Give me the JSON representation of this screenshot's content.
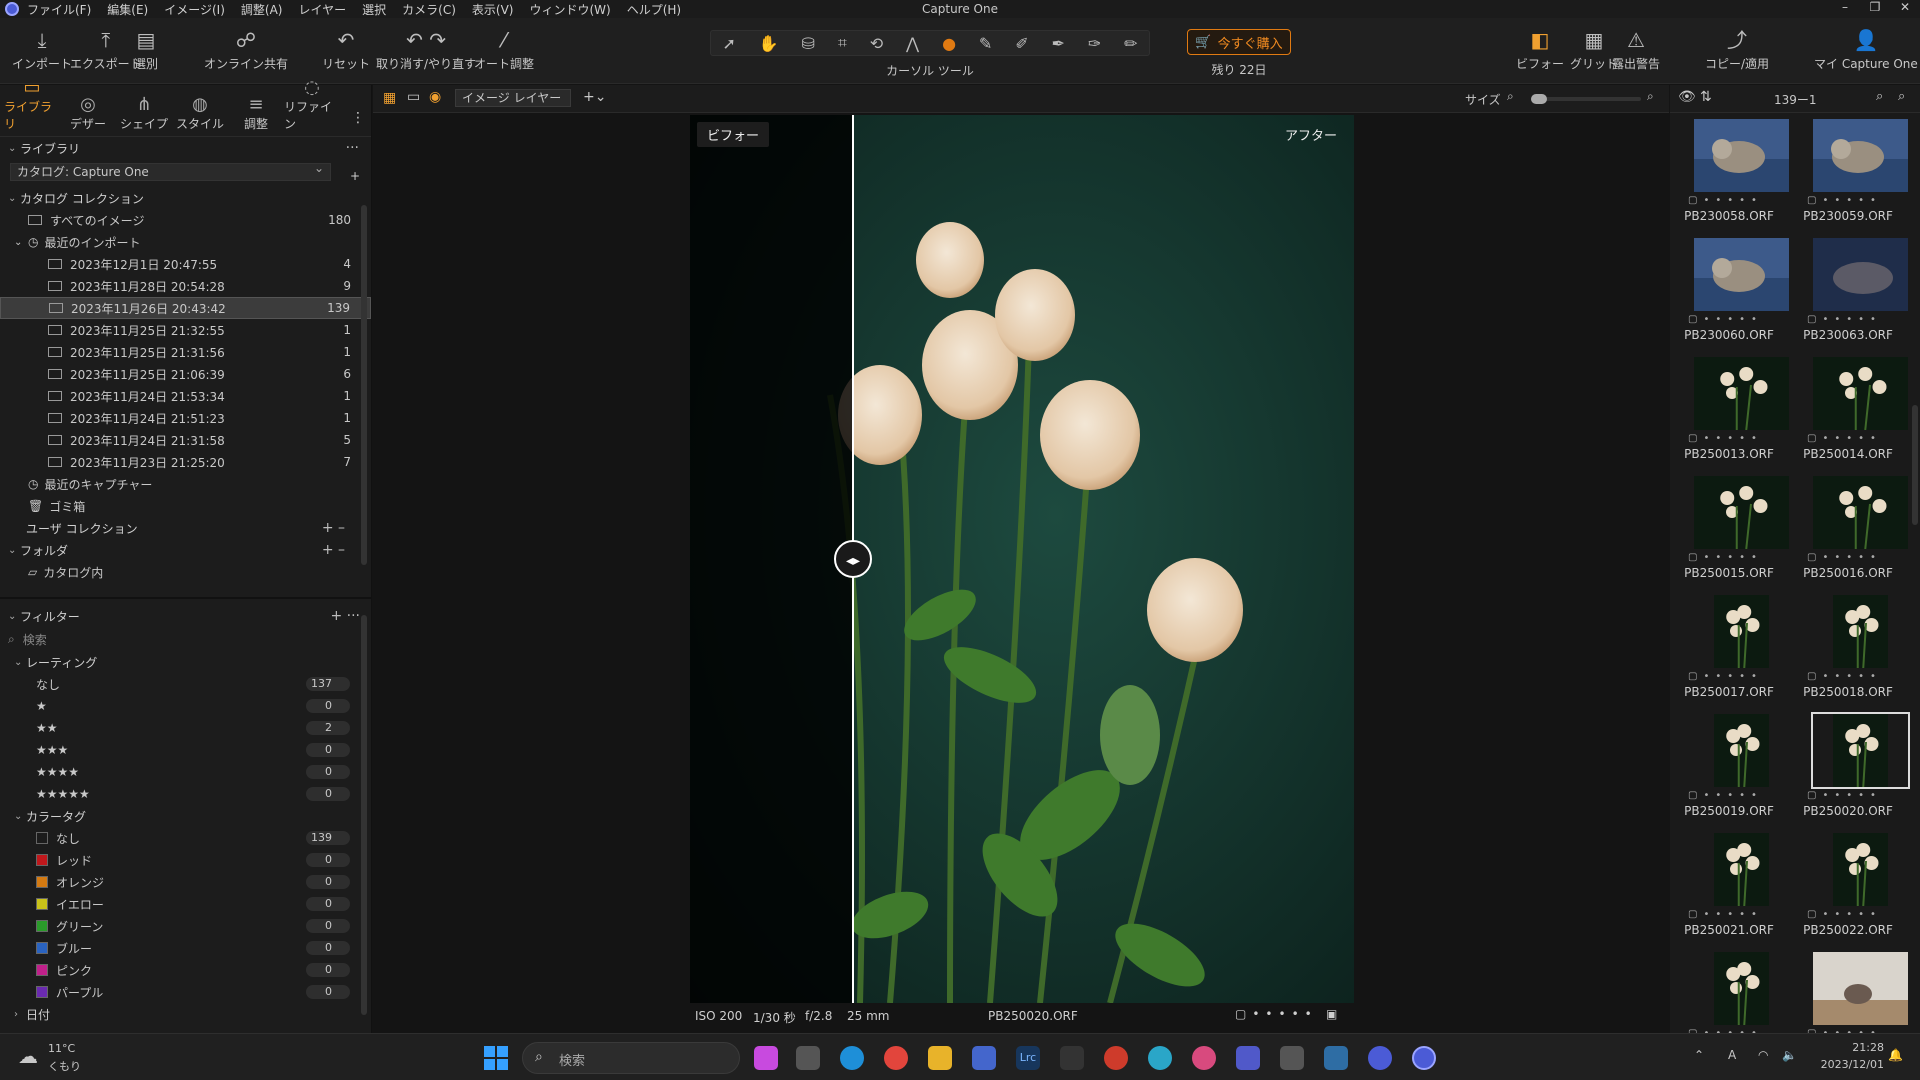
{
  "window": {
    "title": "Capture One"
  },
  "menu": [
    "ファイル(F)",
    "編集(E)",
    "イメージ(I)",
    "調整(A)",
    "レイヤー",
    "選択",
    "カメラ(C)",
    "表示(V)",
    "ウィンドウ(W)",
    "ヘルプ(H)"
  ],
  "toolbar": {
    "import": "インポート",
    "export": "エクスポート",
    "cull": "選別",
    "share": "オンライン共有",
    "reset": "リセット",
    "undo_redo": "取り消す/やり直す",
    "auto": "オート調整",
    "cursor_tools": "カーソル ツール",
    "buy": "今すぐ購入",
    "remaining": "残り 22日",
    "before": "ビフォー",
    "grid": "グリッド",
    "exposure_warning": "露出警告",
    "copy_apply": "コピー/適用",
    "my_capture_one": "マイ Capture One"
  },
  "tool_tabs": [
    "ライブラリ",
    "デザー",
    "シェイプ",
    "スタイル",
    "調整",
    "リファイン"
  ],
  "library": {
    "title": "ライブラリ",
    "catalog_select": "カタログ: Capture One",
    "catalog_collection": "カタログ コレクション",
    "all_images": {
      "label": "すべてのイメージ",
      "count": "180"
    },
    "recent_imports": "最近のインポート",
    "imports": [
      {
        "label": "2023年12月1日 20:47:55",
        "count": "4"
      },
      {
        "label": "2023年11月28日 20:54:28",
        "count": "9"
      },
      {
        "label": "2023年11月26日 20:43:42",
        "count": "139"
      },
      {
        "label": "2023年11月25日 21:32:55",
        "count": "1"
      },
      {
        "label": "2023年11月25日 21:31:56",
        "count": "1"
      },
      {
        "label": "2023年11月25日 21:06:39",
        "count": "6"
      },
      {
        "label": "2023年11月24日 21:53:34",
        "count": "1"
      },
      {
        "label": "2023年11月24日 21:51:23",
        "count": "1"
      },
      {
        "label": "2023年11月24日 21:31:58",
        "count": "5"
      },
      {
        "label": "2023年11月23日 21:25:20",
        "count": "7"
      }
    ],
    "recent_captures": "最近のキャプチャー",
    "trash": "ゴミ箱",
    "user_collections": "ユーザ コレクション",
    "folders": "フォルダ",
    "in_catalog": "カタログ内"
  },
  "filters": {
    "title": "フィルター",
    "search_placeholder": "検索",
    "rating_title": "レーティング",
    "ratings": [
      {
        "label": "なし",
        "count": "137"
      },
      {
        "label": "★",
        "count": "0"
      },
      {
        "label": "★★",
        "count": "2"
      },
      {
        "label": "★★★",
        "count": "0"
      },
      {
        "label": "★★★★",
        "count": "0"
      },
      {
        "label": "★★★★★",
        "count": "0"
      }
    ],
    "color_title": "カラータグ",
    "colors": [
      {
        "label": "なし",
        "count": "139",
        "color": "#1c1c1c"
      },
      {
        "label": "レッド",
        "count": "0",
        "color": "#c0181c"
      },
      {
        "label": "オレンジ",
        "count": "0",
        "color": "#d47a12"
      },
      {
        "label": "イエロー",
        "count": "0",
        "color": "#c9c21a"
      },
      {
        "label": "グリーン",
        "count": "0",
        "color": "#2a9a2a"
      },
      {
        "label": "ブルー",
        "count": "0",
        "color": "#2a63c0"
      },
      {
        "label": "ピンク",
        "count": "0",
        "color": "#c0208a"
      },
      {
        "label": "パープル",
        "count": "0",
        "color": "#6a2ab0"
      }
    ],
    "date_title": "日付"
  },
  "viewer": {
    "layer_select": "イメージ レイヤー",
    "size_label": "サイズ",
    "before_label": "ビフォー",
    "after_label": "アフター",
    "iso": "ISO 200",
    "shutter": "1/30 秒",
    "aperture": "f/2.8",
    "focal": "25 mm",
    "filename": "PB250020.ORF"
  },
  "browser": {
    "count": "139ー1",
    "thumbs": [
      {
        "name": "PB230058.ORF",
        "kind": "cat"
      },
      {
        "name": "PB230059.ORF",
        "kind": "cat"
      },
      {
        "name": "PB230060.ORF",
        "kind": "cat"
      },
      {
        "name": "PB230063.ORF",
        "kind": "cat2"
      },
      {
        "name": "PB250013.ORF",
        "kind": "flower"
      },
      {
        "name": "PB250014.ORF",
        "kind": "flower"
      },
      {
        "name": "PB250015.ORF",
        "kind": "flower"
      },
      {
        "name": "PB250016.ORF",
        "kind": "flower"
      },
      {
        "name": "PB250017.ORF",
        "kind": "flowerv"
      },
      {
        "name": "PB250018.ORF",
        "kind": "flowerv"
      },
      {
        "name": "PB250019.ORF",
        "kind": "flowerv"
      },
      {
        "name": "PB250020.ORF",
        "kind": "flowerv"
      },
      {
        "name": "PB250021.ORF",
        "kind": "flowerv"
      },
      {
        "name": "PB250022.ORF",
        "kind": "flowerv"
      },
      {
        "name": "",
        "kind": "flowerv"
      },
      {
        "name": "",
        "kind": "room"
      }
    ]
  },
  "taskbar": {
    "weather_temp": "11°C",
    "weather_desc": "くもり",
    "search_placeholder": "検索",
    "time": "21:28",
    "date": "2023/12/01",
    "ime": "A"
  }
}
